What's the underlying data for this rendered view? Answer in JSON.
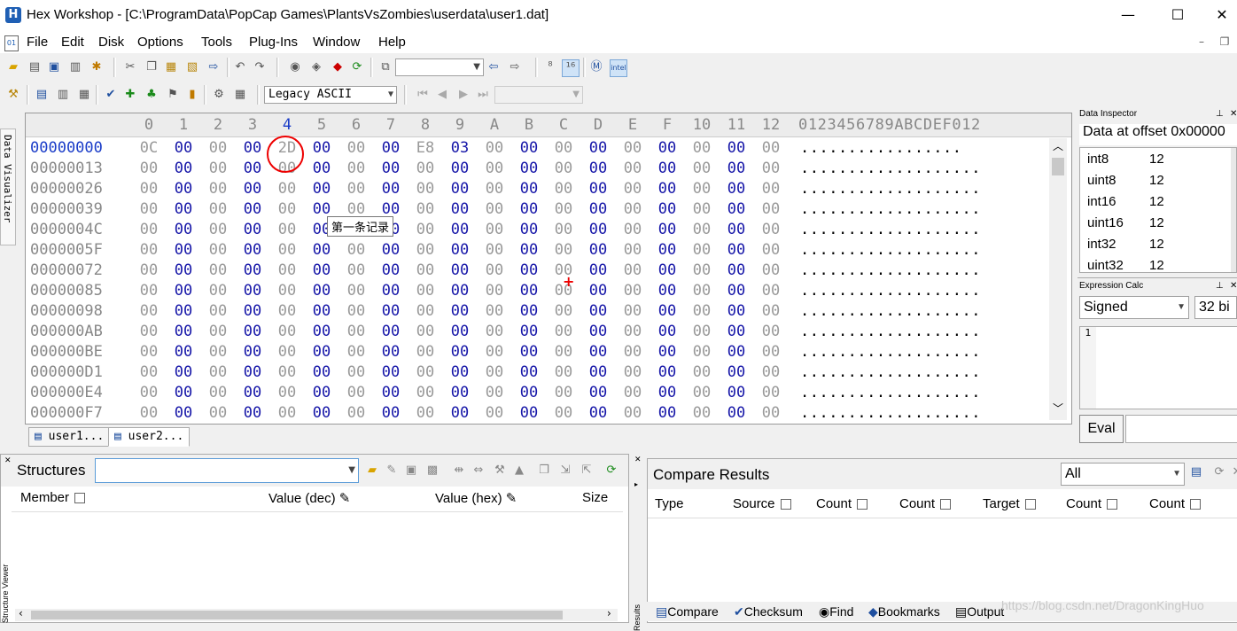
{
  "window": {
    "title": "Hex Workshop - [C:\\ProgramData\\PopCap Games\\PlantsVsZombies\\userdata\\user1.dat]",
    "app_icon_letter": "H",
    "minimize": "—",
    "maximize": "☐",
    "close": "✕"
  },
  "menu": {
    "items": [
      "File",
      "Edit",
      "Disk",
      "Options",
      "Tools",
      "Plug-Ins",
      "Window",
      "Help"
    ],
    "mdi_minimize": "–",
    "mdi_restore": "❐"
  },
  "toolbar": {
    "encoding_combo": "Legacy ASCII"
  },
  "data_visualizer_tab": "Data Visualizer",
  "hex": {
    "column_headers": [
      "0",
      "1",
      "2",
      "3",
      "4",
      "5",
      "6",
      "7",
      "8",
      "9",
      "A",
      "B",
      "C",
      "D",
      "E",
      "F",
      "10",
      "11",
      "12"
    ],
    "active_column": 4,
    "ascii_header": "0123456789ABCDEF012",
    "rows": [
      {
        "addr": "00000000",
        "bytes": [
          "0C",
          "00",
          "00",
          "00",
          "2D",
          "00",
          "00",
          "00",
          "E8",
          "03",
          "00",
          "00",
          "00",
          "00",
          "00",
          "00",
          "00",
          "00",
          "00"
        ],
        "ascii": "................."
      },
      {
        "addr": "00000013",
        "bytes": [
          "00",
          "00",
          "00",
          "00",
          "00",
          "00",
          "00",
          "00",
          "00",
          "00",
          "00",
          "00",
          "00",
          "00",
          "00",
          "00",
          "00",
          "00",
          "00"
        ],
        "ascii": "..................."
      },
      {
        "addr": "00000026",
        "bytes": [
          "00",
          "00",
          "00",
          "00",
          "00",
          "00",
          "00",
          "00",
          "00",
          "00",
          "00",
          "00",
          "00",
          "00",
          "00",
          "00",
          "00",
          "00",
          "00"
        ],
        "ascii": "..................."
      },
      {
        "addr": "00000039",
        "bytes": [
          "00",
          "00",
          "00",
          "00",
          "00",
          "00",
          "00",
          "00",
          "00",
          "00",
          "00",
          "00",
          "00",
          "00",
          "00",
          "00",
          "00",
          "00",
          "00"
        ],
        "ascii": "..................."
      },
      {
        "addr": "0000004C",
        "bytes": [
          "00",
          "00",
          "00",
          "00",
          "00",
          "00",
          "00",
          "00",
          "00",
          "00",
          "00",
          "00",
          "00",
          "00",
          "00",
          "00",
          "00",
          "00",
          "00"
        ],
        "ascii": "..................."
      },
      {
        "addr": "0000005F",
        "bytes": [
          "00",
          "00",
          "00",
          "00",
          "00",
          "00",
          "00",
          "00",
          "00",
          "00",
          "00",
          "00",
          "00",
          "00",
          "00",
          "00",
          "00",
          "00",
          "00"
        ],
        "ascii": "..................."
      },
      {
        "addr": "00000072",
        "bytes": [
          "00",
          "00",
          "00",
          "00",
          "00",
          "00",
          "00",
          "00",
          "00",
          "00",
          "00",
          "00",
          "00",
          "00",
          "00",
          "00",
          "00",
          "00",
          "00"
        ],
        "ascii": "..................."
      },
      {
        "addr": "00000085",
        "bytes": [
          "00",
          "00",
          "00",
          "00",
          "00",
          "00",
          "00",
          "00",
          "00",
          "00",
          "00",
          "00",
          "00",
          "00",
          "00",
          "00",
          "00",
          "00",
          "00"
        ],
        "ascii": "..................."
      },
      {
        "addr": "00000098",
        "bytes": [
          "00",
          "00",
          "00",
          "00",
          "00",
          "00",
          "00",
          "00",
          "00",
          "00",
          "00",
          "00",
          "00",
          "00",
          "00",
          "00",
          "00",
          "00",
          "00"
        ],
        "ascii": "..................."
      },
      {
        "addr": "000000AB",
        "bytes": [
          "00",
          "00",
          "00",
          "00",
          "00",
          "00",
          "00",
          "00",
          "00",
          "00",
          "00",
          "00",
          "00",
          "00",
          "00",
          "00",
          "00",
          "00",
          "00"
        ],
        "ascii": "..................."
      },
      {
        "addr": "000000BE",
        "bytes": [
          "00",
          "00",
          "00",
          "00",
          "00",
          "00",
          "00",
          "00",
          "00",
          "00",
          "00",
          "00",
          "00",
          "00",
          "00",
          "00",
          "00",
          "00",
          "00"
        ],
        "ascii": "..................."
      },
      {
        "addr": "000000D1",
        "bytes": [
          "00",
          "00",
          "00",
          "00",
          "00",
          "00",
          "00",
          "00",
          "00",
          "00",
          "00",
          "00",
          "00",
          "00",
          "00",
          "00",
          "00",
          "00",
          "00"
        ],
        "ascii": "..................."
      },
      {
        "addr": "000000E4",
        "bytes": [
          "00",
          "00",
          "00",
          "00",
          "00",
          "00",
          "00",
          "00",
          "00",
          "00",
          "00",
          "00",
          "00",
          "00",
          "00",
          "00",
          "00",
          "00",
          "00"
        ],
        "ascii": "..................."
      },
      {
        "addr": "000000F7",
        "bytes": [
          "00",
          "00",
          "00",
          "00",
          "00",
          "00",
          "00",
          "00",
          "00",
          "00",
          "00",
          "00",
          "00",
          "00",
          "00",
          "00",
          "00",
          "00",
          "00"
        ],
        "ascii": "..................."
      }
    ],
    "tooltip": "第一条记录",
    "scroll_up": "︿",
    "scroll_down": "﹀",
    "cursor_mark": "+"
  },
  "file_tabs": [
    "user1...",
    "user2..."
  ],
  "data_inspector": {
    "panel_title": "Data Inspector",
    "header": "Data at offset 0x00000",
    "rows": [
      {
        "type": "int8",
        "value": "12"
      },
      {
        "type": "uint8",
        "value": "12"
      },
      {
        "type": "int16",
        "value": "12"
      },
      {
        "type": "uint16",
        "value": "12"
      },
      {
        "type": "int32",
        "value": "12"
      },
      {
        "type": "uint32",
        "value": "12"
      }
    ]
  },
  "expression_calc": {
    "panel_title": "Expression Calc",
    "mode": "Signed",
    "width": "32 bi",
    "line_number": "1",
    "eval_button": "Eval"
  },
  "structures": {
    "label": "Structures",
    "columns": [
      "Member",
      "Value (dec)",
      "Value (hex)",
      "Size"
    ],
    "side_label": "Structure Viewer"
  },
  "compare": {
    "title": "Compare Results",
    "filter": "All",
    "columns": [
      "Type",
      "Source",
      "Count",
      "Count",
      "Target",
      "Count",
      "Count"
    ],
    "side_label": "Results",
    "tabs": [
      "Compare",
      "Checksum",
      "Find",
      "Bookmarks",
      "Output"
    ]
  },
  "watermark": "https://blog.csdn.net/DragonKingHuo"
}
